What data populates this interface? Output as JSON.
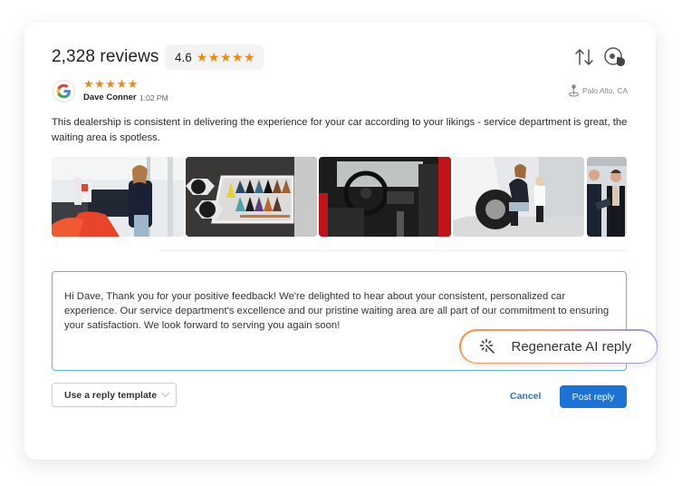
{
  "header": {
    "reviews_count": "2,328 reviews",
    "average_rating": "4.6",
    "average_stars": "★★★★★",
    "sort_icon": "sort-arrows-icon",
    "hide_icon": "hide-view-icon"
  },
  "review": {
    "source_icon": "google-logo-icon",
    "stars": "★★★★★",
    "reviewer_name": "Dave Conner",
    "time": "1:02 PM",
    "location_icon": "map-pin-icon",
    "location": "Palo Alto, CA",
    "text": "This dealership is consistent in delivering the experience for your car according to your likings -  service department is great, the waiting area is spotless.",
    "photos": [
      {
        "label": "woman-in-showroom-photo"
      },
      {
        "label": "wheels-and-leather-swatches-photo"
      },
      {
        "label": "sports-car-interior-photo"
      },
      {
        "label": "mother-and-child-tire-photo"
      },
      {
        "label": "salesmen-talking-photo"
      }
    ]
  },
  "reply": {
    "text": "Hi Dave, Thank you for your positive feedback! We're delighted to hear about your consistent, personalized car experience. Our service department's excellence and our pristine waiting area are all part of our commitment to ensuring your satisfaction. We look forward to serving you again soon!",
    "regenerate_label": "Regenerate AI reply",
    "regenerate_icon": "magic-wand-icon"
  },
  "actions": {
    "template_label": "Use a reply template",
    "cancel_label": "Cancel",
    "post_label": "Post reply"
  },
  "colors": {
    "star": "#f08a0f",
    "primary": "#1c73d6",
    "reply_border": "#5bb8ea",
    "gradient_start": "#f5934a",
    "gradient_end": "#8c97e8"
  }
}
